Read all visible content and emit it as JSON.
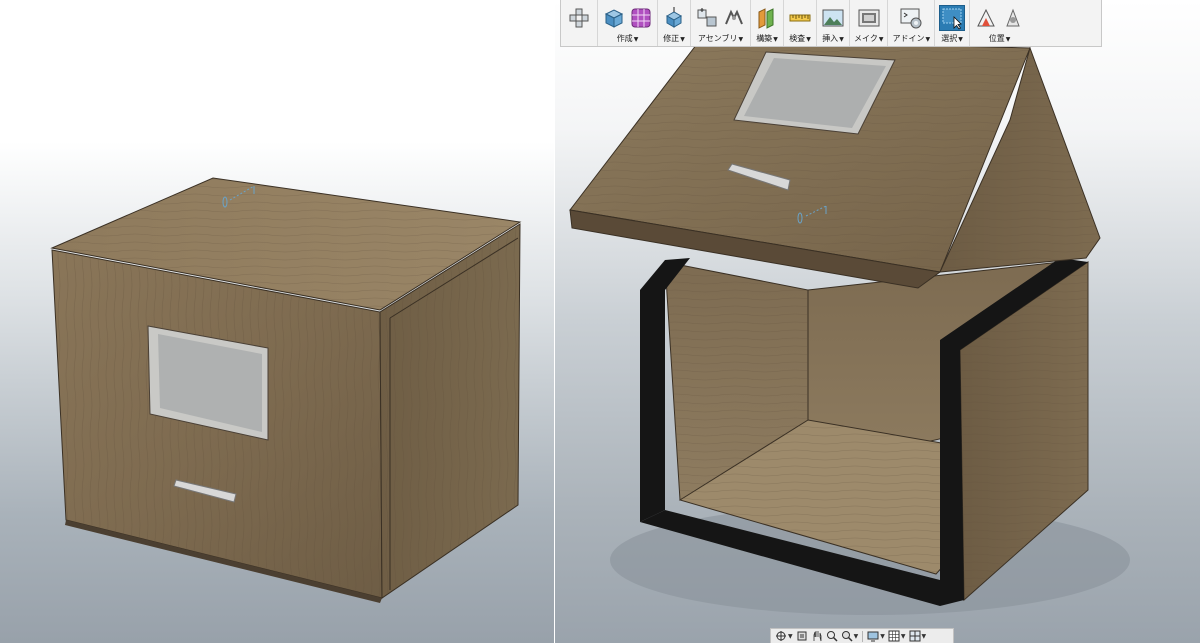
{
  "toolbar": {
    "groups": [
      {
        "id": "create",
        "label": "作成",
        "icons": [
          "box-icon",
          "form-grid-icon"
        ]
      },
      {
        "id": "modify",
        "label": "修正",
        "icons": [
          "press-pull-icon"
        ]
      },
      {
        "id": "assemble",
        "label": "アセンブリ",
        "icons": [
          "new-component-icon",
          "joint-icon"
        ]
      },
      {
        "id": "construct",
        "label": "構築",
        "icons": [
          "offset-plane-icon"
        ]
      },
      {
        "id": "inspect",
        "label": "検査",
        "icons": [
          "measure-icon"
        ]
      },
      {
        "id": "insert",
        "label": "挿入",
        "icons": [
          "insert-image-icon"
        ]
      },
      {
        "id": "make",
        "label": "メイク",
        "icons": [
          "print-3d-icon"
        ]
      },
      {
        "id": "addins",
        "label": "アドイン",
        "icons": [
          "scripts-icon"
        ]
      },
      {
        "id": "select",
        "label": "選択",
        "icons": [
          "select-cursor-icon"
        ],
        "active": true
      },
      {
        "id": "position",
        "label": "位置",
        "icons": [
          "capture-position-icon",
          "revert-position-icon"
        ]
      }
    ],
    "accent": "#2b7cb3"
  },
  "navbar": {
    "buttons": [
      "orbit-icon",
      "look-at-icon",
      "pan-icon",
      "zoom-icon",
      "fit-icon",
      "display-settings-icon",
      "grid-icon",
      "viewports-icon"
    ]
  },
  "viewports": {
    "left": {
      "scene": "closed-wooden-box",
      "material": "walnut"
    },
    "right": {
      "scene": "open-wooden-box",
      "material": "walnut"
    }
  }
}
